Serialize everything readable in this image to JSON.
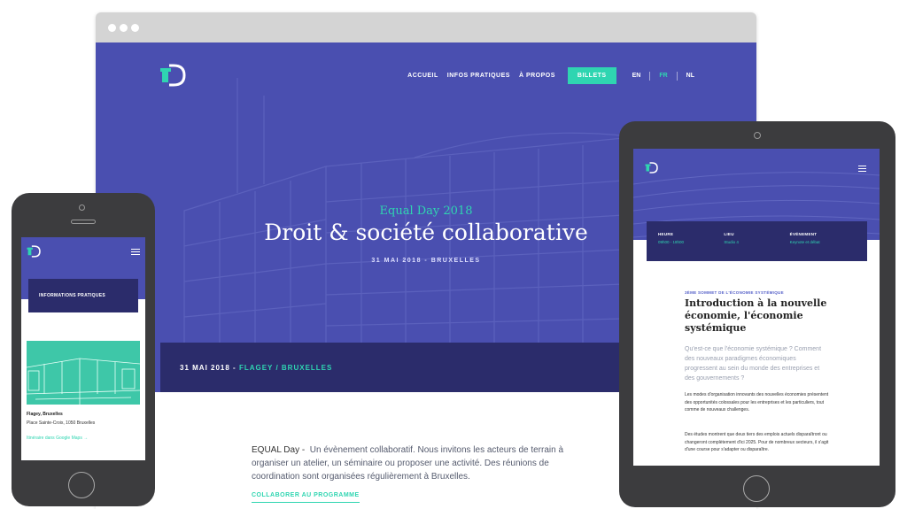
{
  "desktop": {
    "nav": {
      "links": [
        "ACCUEIL",
        "INFOS PRATIQUES",
        "À PROPOS"
      ],
      "cta": "BILLETS",
      "languages": [
        "EN",
        "FR",
        "NL"
      ],
      "active_language": "FR"
    },
    "hero": {
      "kicker": "Equal Day 2018",
      "title": "Droit & société collaborative",
      "date": "31 MAI 2018 - BRUXELLES"
    },
    "date_band": {
      "date": "31 MAI 2018 -",
      "place": "FLAGEY / BRUXELLES"
    },
    "description": {
      "brand": "EQUAL Day -",
      "text": "Un évènement collaboratif. Nous invitons les acteurs de terrain à organiser un atelier, un séminaire ou proposer une activité. Des réunions de coordination sont organisées régulièrement à Bruxelles."
    },
    "cta": "COLLABORER AU PROGRAMME"
  },
  "phone": {
    "card_title": "INFORMATIONS PRATIQUES",
    "place_name": "Flagey, Bruxelles",
    "address": "Place Sainte-Croix, 1050 Bruxelles",
    "map_link": "Itinéraire dans Google Maps →"
  },
  "tablet": {
    "info": [
      {
        "label": "HEURE",
        "value": "09h00 - 18h00"
      },
      {
        "label": "LIEU",
        "value": "Studio 4"
      },
      {
        "label": "ÉVÉNEMENT",
        "value": "Keynote et débat"
      }
    ],
    "kicker": "3ÈME SOMMET DE L'ÉCONOMIE SYSTÉMIQUE",
    "title": "Introduction à la nouvelle économie, l'économie systémique",
    "lead": "Qu'est-ce que l'économie systémique ? Comment des nouveaux paradigmes économiques progressent au sein du monde des entreprises et des gouvernements ?",
    "p1": "Les modes d'organisation innovants des nouvelles économies présentent des opportunités colossales pour les entreprises et les particuliers, tout comme de nouveaux challenges.",
    "p2": "Des études montrent que deux tiers des emplois actuels disparaîtront ou changeront complètement d'ici 2025. Pour de nombreux secteurs, il s'agit d'une course pour s'adapter ou disparaître."
  },
  "colors": {
    "brand_blue": "#4a4fb0",
    "dark_navy": "#2b2c6b",
    "accent_teal": "#2fd5b1"
  }
}
